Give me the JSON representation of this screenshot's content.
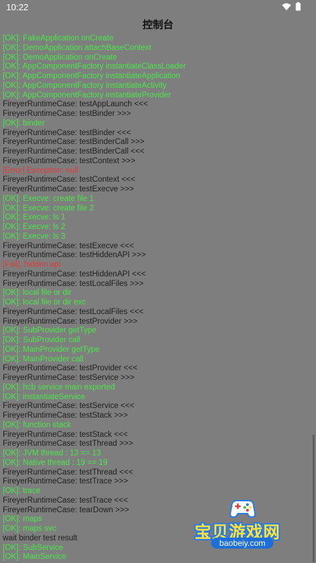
{
  "status_bar": {
    "time": "10:22",
    "icons": [
      "wifi-icon",
      "battery-icon"
    ]
  },
  "app_bar": {
    "title": "控制台"
  },
  "colors": {
    "background": "#7e7e7e",
    "info": "#1e1e1e",
    "ok": "#49e849",
    "error": "#e03a3a"
  },
  "console": {
    "lines": [
      {
        "type": "ok",
        "text": "[OK]: FakeApplication onCreate"
      },
      {
        "type": "ok",
        "text": "[OK]: DemoApplication attachBaseContext"
      },
      {
        "type": "ok",
        "text": "[OK]: DemoApplication onCreate"
      },
      {
        "type": "ok",
        "text": "[OK]: AppComponentFactory instantiateClassLoader"
      },
      {
        "type": "ok",
        "text": "[OK]: AppComponentFactory instantiateApplication"
      },
      {
        "type": "ok",
        "text": "[OK]: AppComponentFactory instantiateActivity"
      },
      {
        "type": "ok",
        "text": "[OK]: AppComponentFactory instantiateProvider"
      },
      {
        "type": "info",
        "text": "FireyerRuntimeCase: testAppLaunch <<<"
      },
      {
        "type": "info",
        "text": "FireyerRuntimeCase: testBinder >>>"
      },
      {
        "type": "ok",
        "text": "[OK]: binder"
      },
      {
        "type": "info",
        "text": "FireyerRuntimeCase: testBinder <<<"
      },
      {
        "type": "info",
        "text": "FireyerRuntimeCase: testBinderCall >>>"
      },
      {
        "type": "info",
        "text": "FireyerRuntimeCase: testBinderCall <<<"
      },
      {
        "type": "info",
        "text": "FireyerRuntimeCase: testContext >>>"
      },
      {
        "type": "error",
        "text": "[Error] Exception: null"
      },
      {
        "type": "info",
        "text": "FireyerRuntimeCase: testContext <<<"
      },
      {
        "type": "info",
        "text": "FireyerRuntimeCase: testExecve >>>"
      },
      {
        "type": "ok",
        "text": "[OK]: Execve: create file 1"
      },
      {
        "type": "ok",
        "text": "[OK]: Execve: create file 2"
      },
      {
        "type": "ok",
        "text": "[OK]: Execve: ls 1"
      },
      {
        "type": "ok",
        "text": "[OK]: Execve: ls 2"
      },
      {
        "type": "ok",
        "text": "[OK]: Execve: ls 3"
      },
      {
        "type": "info",
        "text": "FireyerRuntimeCase: testExecve <<<"
      },
      {
        "type": "info",
        "text": "FireyerRuntimeCase: testHiddenAPI >>>"
      },
      {
        "type": "error",
        "text": "[Fail], hidden api"
      },
      {
        "type": "info",
        "text": "FireyerRuntimeCase: testHiddenAPI <<<"
      },
      {
        "type": "info",
        "text": "FireyerRuntimeCase: testLocalFiles >>>"
      },
      {
        "type": "ok",
        "text": "[OK]: local file or dir"
      },
      {
        "type": "ok",
        "text": "[OK]: local file or dir exc"
      },
      {
        "type": "info",
        "text": "FireyerRuntimeCase: testLocalFiles <<<"
      },
      {
        "type": "info",
        "text": "FireyerRuntimeCase: testProvider >>>"
      },
      {
        "type": "ok",
        "text": "[OK]: SubProvider getType"
      },
      {
        "type": "ok",
        "text": "[OK]: SubProvider call"
      },
      {
        "type": "ok",
        "text": "[OK]: MainProvider getType"
      },
      {
        "type": "ok",
        "text": "[OK]: MainProvider call"
      },
      {
        "type": "info",
        "text": "FireyerRuntimeCase: testProvider <<<"
      },
      {
        "type": "info",
        "text": "FireyerRuntimeCase: testService >>>"
      },
      {
        "type": "ok",
        "text": "[OK]: hcb service main exported"
      },
      {
        "type": "ok",
        "text": "[OK]: instantiateService"
      },
      {
        "type": "info",
        "text": "FireyerRuntimeCase: testService <<<"
      },
      {
        "type": "info",
        "text": "FireyerRuntimeCase: testStack >>>"
      },
      {
        "type": "ok",
        "text": "[OK]: function stack"
      },
      {
        "type": "info",
        "text": "FireyerRuntimeCase: testStack <<<"
      },
      {
        "type": "info",
        "text": "FireyerRuntimeCase: testThread >>>"
      },
      {
        "type": "ok",
        "text": "[OK]: JVM thread : 13 == 13"
      },
      {
        "type": "ok",
        "text": "[OK]: Native thread : 19 == 19"
      },
      {
        "type": "info",
        "text": "FireyerRuntimeCase: testThread <<<"
      },
      {
        "type": "info",
        "text": "FireyerRuntimeCase: testTrace >>>"
      },
      {
        "type": "ok",
        "text": "[OK]: trace"
      },
      {
        "type": "info",
        "text": "FireyerRuntimeCase: testTrace <<<"
      },
      {
        "type": "info",
        "text": "FireyerRuntimeCase: tearDown >>>"
      },
      {
        "type": "ok",
        "text": "[OK]: maps"
      },
      {
        "type": "ok",
        "text": "[OK]: maps svc"
      },
      {
        "type": "info",
        "text": "wait binder test result"
      },
      {
        "type": "ok",
        "text": "[OK]: SubService"
      },
      {
        "type": "ok",
        "text": "[OK]: MainService"
      }
    ]
  },
  "watermark": {
    "logo": "gamepad-icon",
    "text": "宝贝游戏网",
    "url": "baobeiy.com"
  }
}
